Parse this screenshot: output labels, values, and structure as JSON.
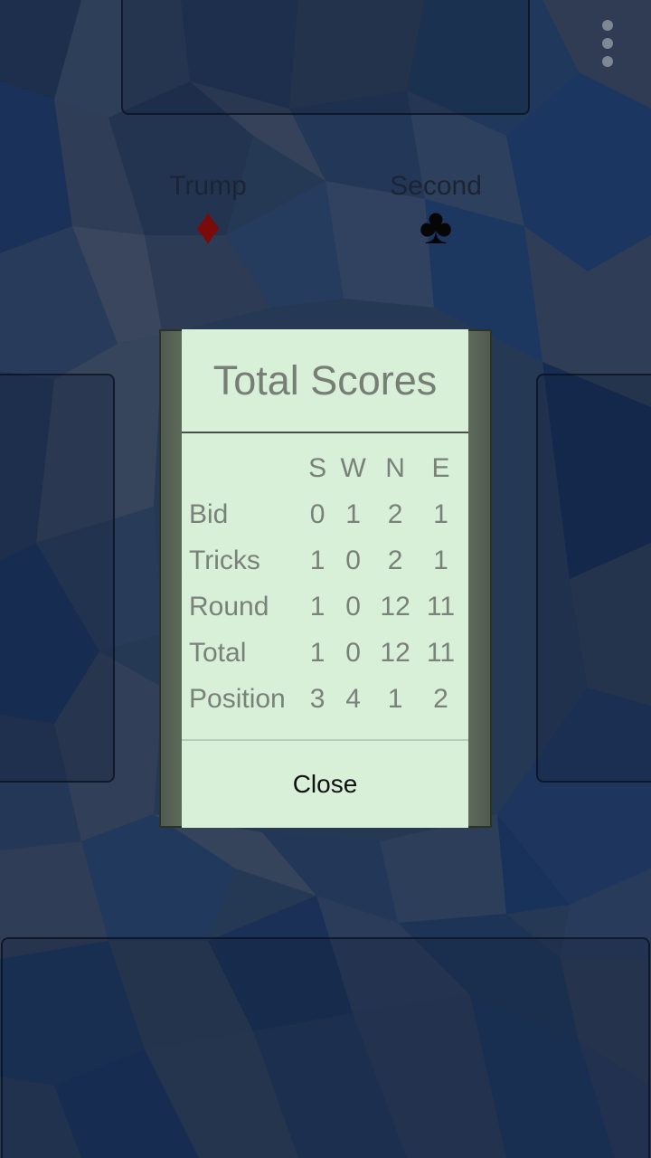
{
  "trump": {
    "label": "Trump",
    "suit_glyph": "♦",
    "color": "#7b0a0a"
  },
  "second": {
    "label": "Second",
    "suit_glyph": "♣",
    "color": "#060606"
  },
  "menu": {
    "icon": "more-vertical-icon"
  },
  "dialog": {
    "title": "Total Scores",
    "headers": [
      "",
      "S",
      "W",
      "N",
      "E"
    ],
    "rows": [
      {
        "label": "Bid",
        "values": [
          "0",
          "1",
          "2",
          "1"
        ]
      },
      {
        "label": "Tricks",
        "values": [
          "1",
          "0",
          "2",
          "1"
        ]
      },
      {
        "label": "Round",
        "values": [
          "1",
          "0",
          "12",
          "11"
        ]
      },
      {
        "label": "Total",
        "values": [
          "1",
          "0",
          "12",
          "11"
        ]
      },
      {
        "label": "Position",
        "values": [
          "3",
          "4",
          "1",
          "2"
        ]
      }
    ],
    "close_label": "Close"
  },
  "colors": {
    "background": "#2f4463",
    "dialog_bg": "#d8f0d8",
    "dialog_text": "#7a817a"
  }
}
